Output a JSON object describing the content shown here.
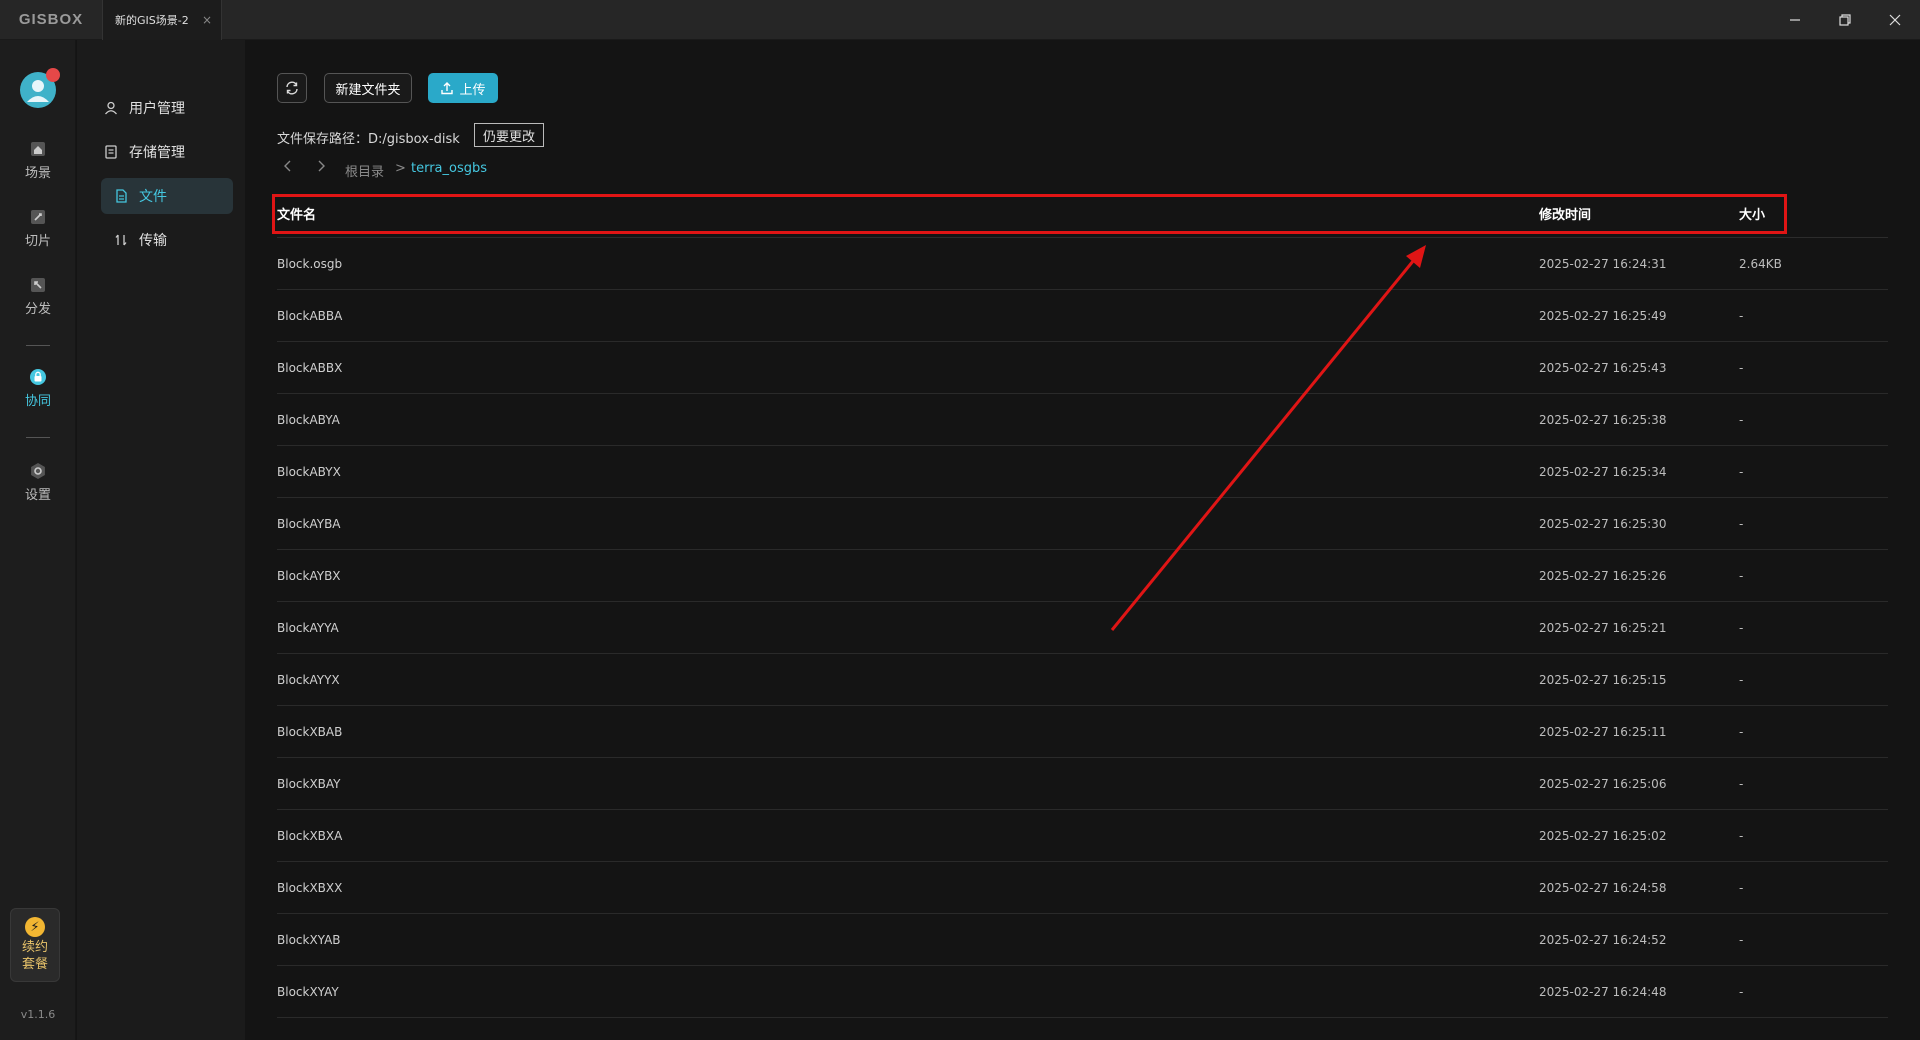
{
  "app": {
    "logo": "GISBOX",
    "tab_title": "新的GIS场景-2",
    "tab_close": "×"
  },
  "window_controls": {
    "minimize": "—",
    "restore": "❐",
    "close": "✕"
  },
  "rail": {
    "items": [
      {
        "label": "场景",
        "icon": "home-icon"
      },
      {
        "label": "切片",
        "icon": "slice-icon"
      },
      {
        "label": "分发",
        "icon": "distribute-icon"
      },
      {
        "label": "协同",
        "icon": "lock-icon",
        "active": true
      },
      {
        "label": "设置",
        "icon": "settings-icon"
      }
    ],
    "promo_line1": "续约",
    "promo_line2": "套餐",
    "version": "v1.1.6"
  },
  "submenu": {
    "items": [
      {
        "label": "用户管理",
        "icon": "user-icon"
      },
      {
        "label": "存储管理",
        "icon": "storage-icon"
      },
      {
        "label": "文件",
        "icon": "file-icon",
        "active": true
      },
      {
        "label": "传输",
        "icon": "transfer-icon"
      }
    ]
  },
  "toolbar": {
    "new_folder": "新建文件夹",
    "upload": "上传"
  },
  "storage": {
    "path_label": "文件保存路径：D:/gisbox-disk",
    "change_button": "仍要更改"
  },
  "breadcrumb": {
    "root": "根目录",
    "separator": ">",
    "current": "terra_osgbs"
  },
  "table": {
    "headers": {
      "name": "文件名",
      "time": "修改时间",
      "size": "大小"
    },
    "rows": [
      {
        "name": "Block.osgb",
        "time": "2025-02-27 16:24:31",
        "size": "2.64KB"
      },
      {
        "name": "BlockABBA",
        "time": "2025-02-27 16:25:49",
        "size": "-"
      },
      {
        "name": "BlockABBX",
        "time": "2025-02-27 16:25:43",
        "size": "-"
      },
      {
        "name": "BlockABYA",
        "time": "2025-02-27 16:25:38",
        "size": "-"
      },
      {
        "name": "BlockABYX",
        "time": "2025-02-27 16:25:34",
        "size": "-"
      },
      {
        "name": "BlockAYBA",
        "time": "2025-02-27 16:25:30",
        "size": "-"
      },
      {
        "name": "BlockAYBX",
        "time": "2025-02-27 16:25:26",
        "size": "-"
      },
      {
        "name": "BlockAYYA",
        "time": "2025-02-27 16:25:21",
        "size": "-"
      },
      {
        "name": "BlockAYYX",
        "time": "2025-02-27 16:25:15",
        "size": "-"
      },
      {
        "name": "BlockXBAB",
        "time": "2025-02-27 16:25:11",
        "size": "-"
      },
      {
        "name": "BlockXBAY",
        "time": "2025-02-27 16:25:06",
        "size": "-"
      },
      {
        "name": "BlockXBXA",
        "time": "2025-02-27 16:25:02",
        "size": "-"
      },
      {
        "name": "BlockXBXX",
        "time": "2025-02-27 16:24:58",
        "size": "-"
      },
      {
        "name": "BlockXYAB",
        "time": "2025-02-27 16:24:52",
        "size": "-"
      },
      {
        "name": "BlockXYAY",
        "time": "2025-02-27 16:24:48",
        "size": "-"
      }
    ]
  },
  "colors": {
    "accent": "#45c7e0",
    "upload_button": "#2aa9c9",
    "annotation": "#e01515"
  }
}
